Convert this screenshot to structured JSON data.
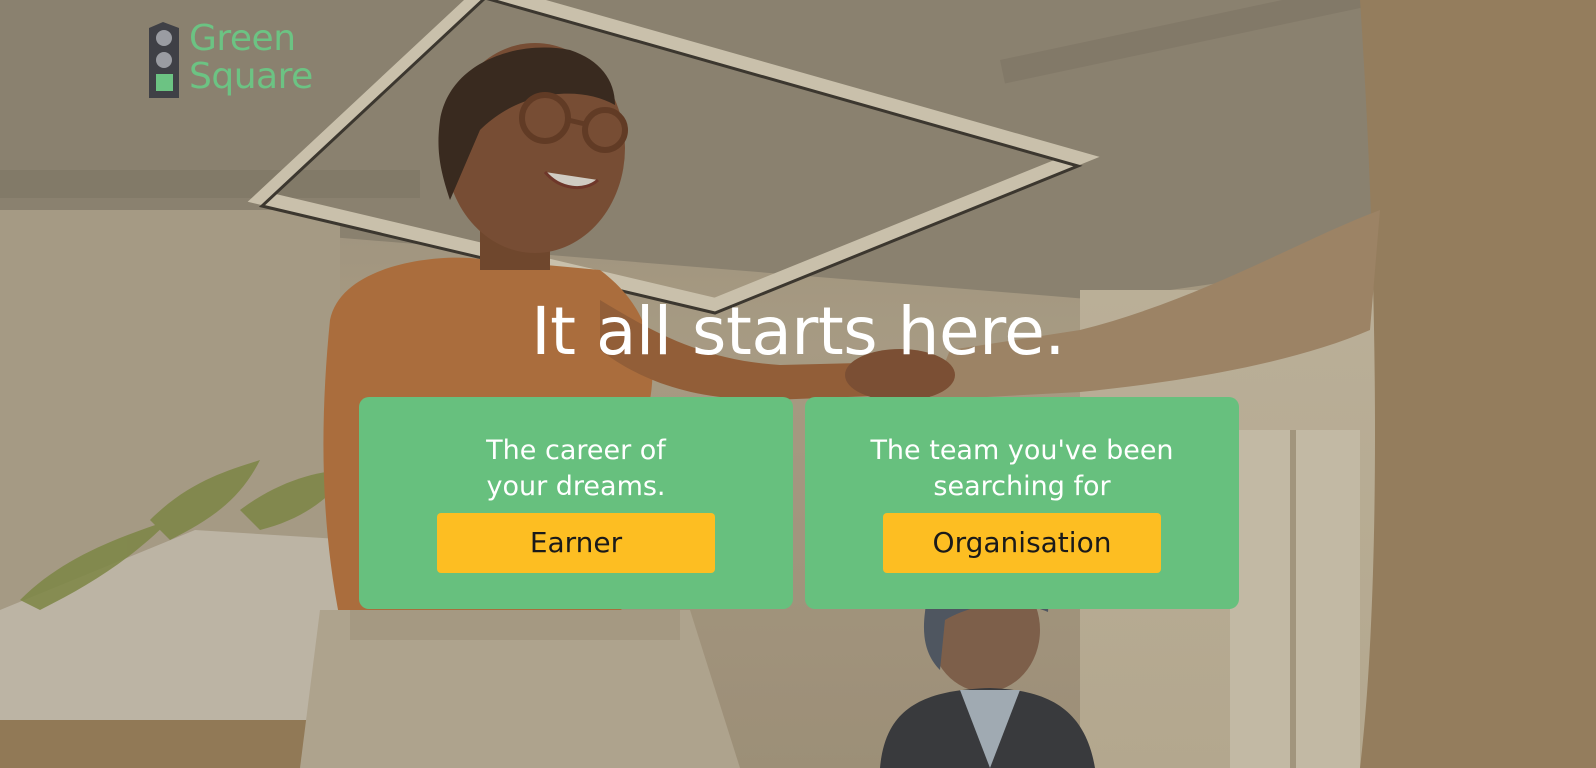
{
  "brand": {
    "name_line1": "Green",
    "name_line2": "Square",
    "icon": "traffic-light-logo-icon",
    "color": "#6cc383"
  },
  "hero": {
    "headline": "It all starts here.",
    "background": "office-handshake-photo"
  },
  "cards": [
    {
      "line1": "The career of",
      "line2": "your dreams.",
      "button_label": "Earner"
    },
    {
      "line1": "The team you've been",
      "line2": "searching for",
      "button_label": "Organisation"
    }
  ],
  "colors": {
    "card_bg": "#67c07e",
    "button_bg": "#fdbe22",
    "headline": "#ffffff"
  }
}
